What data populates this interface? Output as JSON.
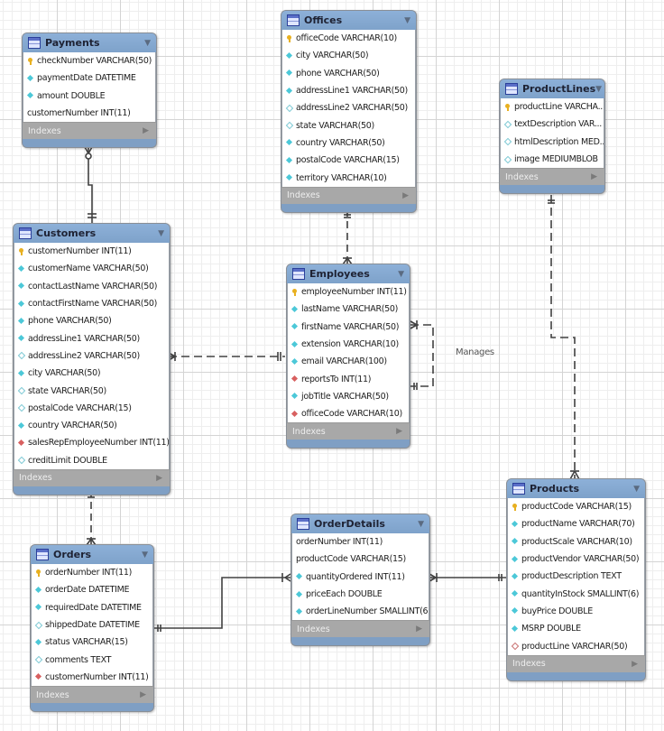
{
  "diagram": {
    "relationship_label": "Manages",
    "indexes_label": "Indexes",
    "tables": {
      "payments": {
        "name": "Payments",
        "columns": [
          {
            "text": "checkNumber VARCHAR(50)",
            "icon": "primary-key"
          },
          {
            "text": "paymentDate DATETIME",
            "icon": "not-null"
          },
          {
            "text": "amount DOUBLE",
            "icon": "not-null"
          },
          {
            "text": "customerNumber INT(11)",
            "icon": "none"
          }
        ]
      },
      "offices": {
        "name": "Offices",
        "columns": [
          {
            "text": "officeCode VARCHAR(10)",
            "icon": "primary-key"
          },
          {
            "text": "city VARCHAR(50)",
            "icon": "not-null"
          },
          {
            "text": "phone VARCHAR(50)",
            "icon": "not-null"
          },
          {
            "text": "addressLine1 VARCHAR(50)",
            "icon": "not-null"
          },
          {
            "text": "addressLine2 VARCHAR(50)",
            "icon": "nullable"
          },
          {
            "text": "state VARCHAR(50)",
            "icon": "nullable"
          },
          {
            "text": "country VARCHAR(50)",
            "icon": "not-null"
          },
          {
            "text": "postalCode VARCHAR(15)",
            "icon": "not-null"
          },
          {
            "text": "territory VARCHAR(10)",
            "icon": "not-null"
          }
        ]
      },
      "productlines": {
        "name": "ProductLines",
        "columns": [
          {
            "text": "productLine VARCHA...",
            "icon": "primary-key"
          },
          {
            "text": "textDescription VAR...",
            "icon": "nullable"
          },
          {
            "text": "htmlDescription MED...",
            "icon": "nullable"
          },
          {
            "text": "image MEDIUMBLOB",
            "icon": "nullable"
          }
        ]
      },
      "customers": {
        "name": "Customers",
        "columns": [
          {
            "text": "customerNumber INT(11)",
            "icon": "primary-key"
          },
          {
            "text": "customerName VARCHAR(50)",
            "icon": "not-null"
          },
          {
            "text": "contactLastName VARCHAR(50)",
            "icon": "not-null"
          },
          {
            "text": "contactFirstName VARCHAR(50)",
            "icon": "not-null"
          },
          {
            "text": "phone VARCHAR(50)",
            "icon": "not-null"
          },
          {
            "text": "addressLine1 VARCHAR(50)",
            "icon": "not-null"
          },
          {
            "text": "addressLine2 VARCHAR(50)",
            "icon": "nullable"
          },
          {
            "text": "city VARCHAR(50)",
            "icon": "not-null"
          },
          {
            "text": "state VARCHAR(50)",
            "icon": "nullable"
          },
          {
            "text": "postalCode VARCHAR(15)",
            "icon": "nullable"
          },
          {
            "text": "country VARCHAR(50)",
            "icon": "not-null"
          },
          {
            "text": "salesRepEmployeeNumber INT(11)",
            "icon": "foreign-key"
          },
          {
            "text": "creditLimit DOUBLE",
            "icon": "nullable"
          }
        ]
      },
      "employees": {
        "name": "Employees",
        "columns": [
          {
            "text": "employeeNumber INT(11)",
            "icon": "primary-key"
          },
          {
            "text": "lastName VARCHAR(50)",
            "icon": "not-null"
          },
          {
            "text": "firstName VARCHAR(50)",
            "icon": "not-null"
          },
          {
            "text": "extension VARCHAR(10)",
            "icon": "not-null"
          },
          {
            "text": "email VARCHAR(100)",
            "icon": "not-null"
          },
          {
            "text": "reportsTo INT(11)",
            "icon": "foreign-key"
          },
          {
            "text": "jobTitle VARCHAR(50)",
            "icon": "not-null"
          },
          {
            "text": "officeCode VARCHAR(10)",
            "icon": "foreign-key"
          }
        ]
      },
      "products": {
        "name": "Products",
        "columns": [
          {
            "text": "productCode VARCHAR(15)",
            "icon": "primary-key"
          },
          {
            "text": "productName VARCHAR(70)",
            "icon": "not-null"
          },
          {
            "text": "productScale VARCHAR(10)",
            "icon": "not-null"
          },
          {
            "text": "productVendor VARCHAR(50)",
            "icon": "not-null"
          },
          {
            "text": "productDescription TEXT",
            "icon": "not-null"
          },
          {
            "text": "quantityInStock SMALLINT(6)",
            "icon": "not-null"
          },
          {
            "text": "buyPrice DOUBLE",
            "icon": "not-null"
          },
          {
            "text": "MSRP DOUBLE",
            "icon": "not-null"
          },
          {
            "text": "productLine VARCHAR(50)",
            "icon": "foreign-key-nullable"
          }
        ]
      },
      "orderdetails": {
        "name": "OrderDetails",
        "columns": [
          {
            "text": "orderNumber INT(11)",
            "icon": "none"
          },
          {
            "text": "productCode VARCHAR(15)",
            "icon": "none"
          },
          {
            "text": "quantityOrdered INT(11)",
            "icon": "not-null"
          },
          {
            "text": "priceEach DOUBLE",
            "icon": "not-null"
          },
          {
            "text": "orderLineNumber SMALLINT(6)",
            "icon": "not-null"
          }
        ]
      },
      "orders": {
        "name": "Orders",
        "columns": [
          {
            "text": "orderNumber INT(11)",
            "icon": "primary-key"
          },
          {
            "text": "orderDate DATETIME",
            "icon": "not-null"
          },
          {
            "text": "requiredDate DATETIME",
            "icon": "not-null"
          },
          {
            "text": "shippedDate DATETIME",
            "icon": "nullable"
          },
          {
            "text": "status VARCHAR(15)",
            "icon": "not-null"
          },
          {
            "text": "comments TEXT",
            "icon": "nullable"
          },
          {
            "text": "customerNumber INT(11)",
            "icon": "foreign-key"
          }
        ]
      }
    },
    "relationships": [
      {
        "from": "customers",
        "to": "payments",
        "style": "solid",
        "from_end": "one",
        "to_end": "zero-or-many"
      },
      {
        "from": "offices",
        "to": "employees",
        "style": "dashed",
        "from_end": "one",
        "to_end": "many"
      },
      {
        "from": "employees",
        "to": "customers",
        "style": "dashed",
        "from_end": "one",
        "to_end": "many"
      },
      {
        "from": "employees",
        "to": "employees",
        "style": "dashed",
        "label": "Manages",
        "from_end": "one",
        "to_end": "many"
      },
      {
        "from": "productlines",
        "to": "products",
        "style": "dashed",
        "from_end": "one",
        "to_end": "many"
      },
      {
        "from": "customers",
        "to": "orders",
        "style": "dashed",
        "from_end": "one",
        "to_end": "many"
      },
      {
        "from": "orders",
        "to": "orderdetails",
        "style": "solid",
        "from_end": "one",
        "to_end": "many"
      },
      {
        "from": "products",
        "to": "orderdetails",
        "style": "solid",
        "from_end": "one",
        "to_end": "many"
      }
    ]
  }
}
